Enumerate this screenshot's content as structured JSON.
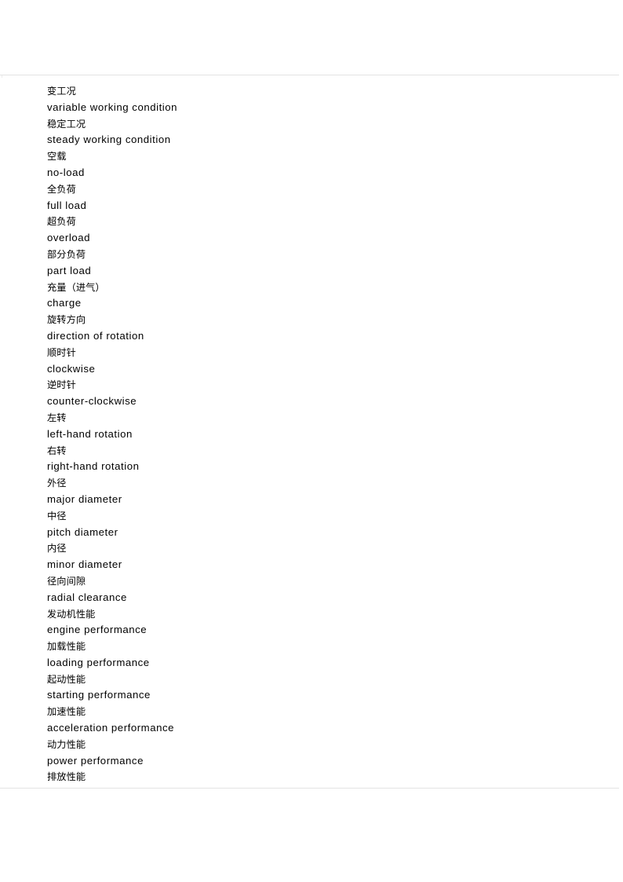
{
  "document": {
    "type": "bilingual-glossary",
    "language_pair": "Chinese-English",
    "entry_count": 23
  },
  "rules": {
    "top_color": "#e3e3e3",
    "bottom_color": "#e3e3e3"
  },
  "glossary": {
    "entries": [
      {
        "zh": "变工况",
        "en": "variable working condition"
      },
      {
        "zh": "稳定工况",
        "en": "steady working condition"
      },
      {
        "zh": "空载",
        "en": "no-load"
      },
      {
        "zh": "全负荷",
        "en": "full load"
      },
      {
        "zh": "超负荷",
        "en": "overload"
      },
      {
        "zh": "部分负荷",
        "en": "part load"
      },
      {
        "zh": "充量（进气）",
        "en": "charge"
      },
      {
        "zh": "旋转方向",
        "en": "direction of rotation"
      },
      {
        "zh": "顺时针",
        "en": "clockwise"
      },
      {
        "zh": "逆时针",
        "en": "counter-clockwise"
      },
      {
        "zh": "左转",
        "en": "left-hand rotation"
      },
      {
        "zh": "右转",
        "en": "right-hand rotation"
      },
      {
        "zh": "外径",
        "en": "major diameter"
      },
      {
        "zh": "中径",
        "en": "pitch diameter"
      },
      {
        "zh": "内径",
        "en": "minor diameter"
      },
      {
        "zh": "径向间隙",
        "en": "radial clearance"
      },
      {
        "zh": "发动机性能",
        "en": "engine performance"
      },
      {
        "zh": "加载性能",
        "en": "loading performance"
      },
      {
        "zh": "起动性能",
        "en": "starting performance"
      },
      {
        "zh": "加速性能",
        "en": "acceleration performance"
      },
      {
        "zh": "动力性能",
        "en": "power performance"
      },
      {
        "zh": "排放性能",
        "en": ""
      }
    ]
  }
}
